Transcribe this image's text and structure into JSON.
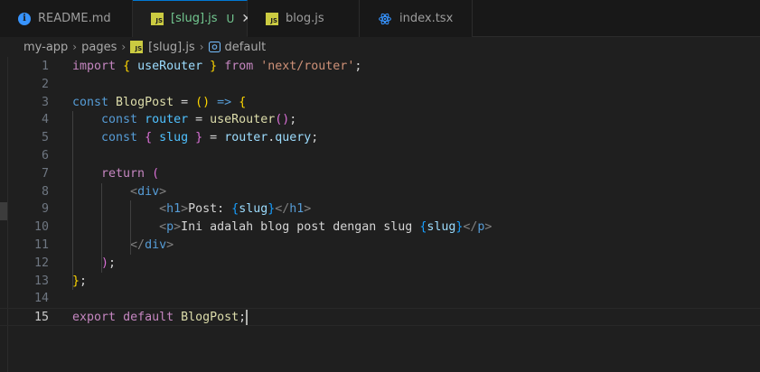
{
  "tabs": [
    {
      "label": "README.md",
      "icon": "info-icon"
    },
    {
      "label": "[slug].js",
      "icon": "js-file-icon",
      "modified": "U",
      "close": "✕"
    },
    {
      "label": "blog.js",
      "icon": "js-file-icon"
    },
    {
      "label": "index.tsx",
      "icon": "react-icon"
    }
  ],
  "icon_text": {
    "info": "i",
    "js": "JS"
  },
  "breadcrumb": {
    "items": [
      "my-app",
      "pages",
      "[slug].js",
      "default"
    ],
    "separator": "›"
  },
  "editor": {
    "current_line": 15,
    "lines": [
      {
        "n": "1",
        "tokens": [
          [
            "kw2",
            "import"
          ],
          [
            "plain",
            " "
          ],
          [
            "br1",
            "{"
          ],
          [
            "plain",
            " "
          ],
          [
            "var",
            "useRouter"
          ],
          [
            "plain",
            " "
          ],
          [
            "br1",
            "}"
          ],
          [
            "plain",
            " "
          ],
          [
            "kw2",
            "from"
          ],
          [
            "plain",
            " "
          ],
          [
            "str",
            "'next/router'"
          ],
          [
            "plain",
            ";"
          ]
        ]
      },
      {
        "n": "2",
        "tokens": []
      },
      {
        "n": "3",
        "tokens": [
          [
            "kw",
            "const"
          ],
          [
            "plain",
            " "
          ],
          [
            "fn",
            "BlogPost"
          ],
          [
            "plain",
            " = "
          ],
          [
            "br1",
            "()"
          ],
          [
            "plain",
            " "
          ],
          [
            "kw",
            "=>"
          ],
          [
            "plain",
            " "
          ],
          [
            "br1",
            "{"
          ]
        ]
      },
      {
        "n": "4",
        "tokens": [
          [
            "plain",
            "    "
          ],
          [
            "kw",
            "const"
          ],
          [
            "plain",
            " "
          ],
          [
            "const",
            "router"
          ],
          [
            "plain",
            " = "
          ],
          [
            "fn",
            "useRouter"
          ],
          [
            "br2",
            "()"
          ],
          [
            "plain",
            ";"
          ]
        ]
      },
      {
        "n": "5",
        "tokens": [
          [
            "plain",
            "    "
          ],
          [
            "kw",
            "const"
          ],
          [
            "plain",
            " "
          ],
          [
            "br2",
            "{"
          ],
          [
            "plain",
            " "
          ],
          [
            "const",
            "slug"
          ],
          [
            "plain",
            " "
          ],
          [
            "br2",
            "}"
          ],
          [
            "plain",
            " = "
          ],
          [
            "var",
            "router"
          ],
          [
            "plain",
            "."
          ],
          [
            "var",
            "query"
          ],
          [
            "plain",
            ";"
          ]
        ]
      },
      {
        "n": "6",
        "tokens": []
      },
      {
        "n": "7",
        "tokens": [
          [
            "plain",
            "    "
          ],
          [
            "kw2",
            "return"
          ],
          [
            "plain",
            " "
          ],
          [
            "br2",
            "("
          ]
        ]
      },
      {
        "n": "8",
        "tokens": [
          [
            "plain",
            "        "
          ],
          [
            "punc",
            "<"
          ],
          [
            "tag",
            "div"
          ],
          [
            "punc",
            ">"
          ]
        ]
      },
      {
        "n": "9",
        "tokens": [
          [
            "plain",
            "            "
          ],
          [
            "punc",
            "<"
          ],
          [
            "tag",
            "h1"
          ],
          [
            "punc",
            ">"
          ],
          [
            "txt",
            "Post: "
          ],
          [
            "br3",
            "{"
          ],
          [
            "var",
            "slug"
          ],
          [
            "br3",
            "}"
          ],
          [
            "punc",
            "</"
          ],
          [
            "tag",
            "h1"
          ],
          [
            "punc",
            ">"
          ]
        ]
      },
      {
        "n": "10",
        "tokens": [
          [
            "plain",
            "            "
          ],
          [
            "punc",
            "<"
          ],
          [
            "tag",
            "p"
          ],
          [
            "punc",
            ">"
          ],
          [
            "txt",
            "Ini adalah blog post dengan slug "
          ],
          [
            "br3",
            "{"
          ],
          [
            "var",
            "slug"
          ],
          [
            "br3",
            "}"
          ],
          [
            "punc",
            "</"
          ],
          [
            "tag",
            "p"
          ],
          [
            "punc",
            ">"
          ]
        ]
      },
      {
        "n": "11",
        "tokens": [
          [
            "plain",
            "        "
          ],
          [
            "punc",
            "</"
          ],
          [
            "tag",
            "div"
          ],
          [
            "punc",
            ">"
          ]
        ]
      },
      {
        "n": "12",
        "tokens": [
          [
            "plain",
            "    "
          ],
          [
            "br2",
            ")"
          ],
          [
            "plain",
            ";"
          ]
        ]
      },
      {
        "n": "13",
        "tokens": [
          [
            "br1",
            "}"
          ],
          [
            "plain",
            ";"
          ]
        ]
      },
      {
        "n": "14",
        "tokens": []
      },
      {
        "n": "15",
        "tokens": [
          [
            "kw2",
            "export"
          ],
          [
            "plain",
            " "
          ],
          [
            "kw2",
            "default"
          ],
          [
            "plain",
            " "
          ],
          [
            "fn",
            "BlogPost"
          ],
          [
            "plain",
            ";"
          ]
        ]
      }
    ]
  }
}
